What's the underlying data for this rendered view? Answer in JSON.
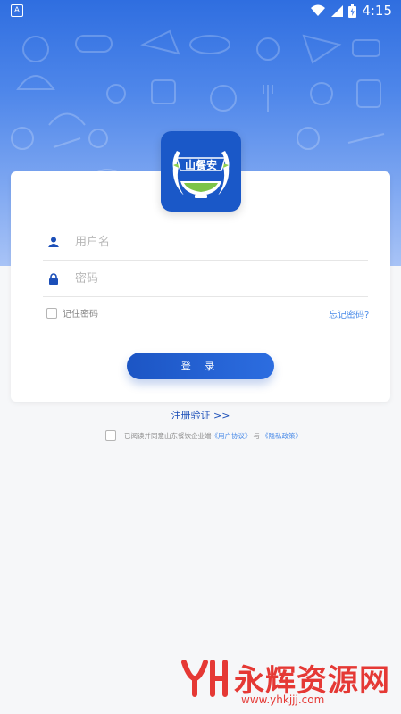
{
  "status_bar": {
    "left_icon": "A",
    "time": "4:15",
    "icons": [
      "wifi-icon",
      "signal-icon",
      "battery-icon"
    ]
  },
  "logo": {
    "text": "山餐安"
  },
  "form": {
    "username": {
      "value": "",
      "placeholder": "用户名",
      "icon": "user-icon"
    },
    "password": {
      "value": "",
      "placeholder": "密码",
      "icon": "lock-icon"
    },
    "remember_label": "记住密码",
    "forgot_label": "忘记密码?",
    "login_label": "登 录"
  },
  "register_link": "注册验证 >>",
  "agreement": {
    "prefix": "已阅读并同意山东餐饮企业端",
    "user_agreement": "《用户协议》",
    "conjunction": "与",
    "privacy_policy": "《隐私政策》"
  },
  "watermark": {
    "text": "永辉资源网",
    "url": "www.yhkjjj.com"
  },
  "colors": {
    "primary": "#1c55c4",
    "link": "#4a8be8",
    "header_top": "#2f6ee0",
    "header_bottom": "#a8c3f6",
    "watermark": "#e53935"
  }
}
